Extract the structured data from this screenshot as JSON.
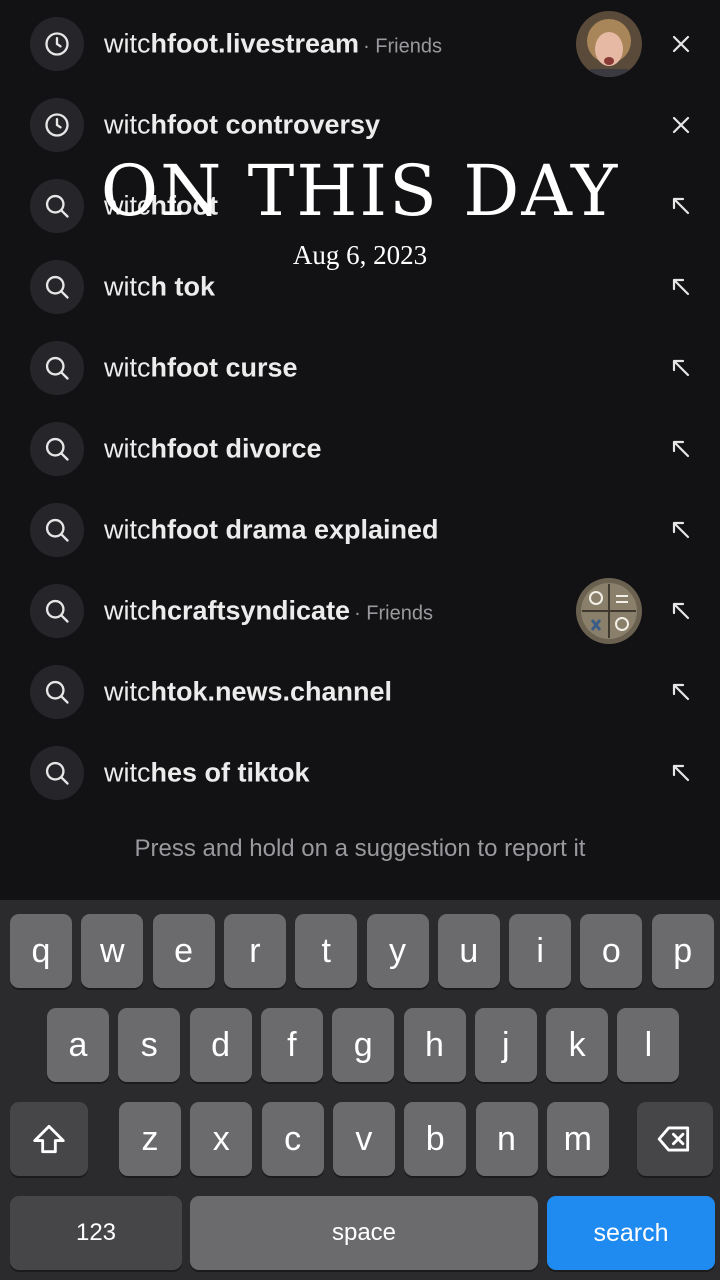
{
  "overlay": {
    "title": "ON THIS DAY",
    "date": "Aug 6, 2023"
  },
  "suggestions": [
    {
      "icon": "clock-icon",
      "prefix": "witc",
      "rest": "hfoot.livestream",
      "tag": "· Friends",
      "action": "remove-icon",
      "avatar": "person"
    },
    {
      "icon": "clock-icon",
      "prefix": "witc",
      "rest": "hfoot controversy",
      "tag": "",
      "action": "remove-icon",
      "avatar": ""
    },
    {
      "icon": "search-icon",
      "prefix": "witc",
      "rest": "hfoot",
      "tag": "",
      "action": "arrow-up-left-icon",
      "avatar": ""
    },
    {
      "icon": "search-icon",
      "prefix": "witc",
      "rest": "h tok",
      "tag": "",
      "action": "arrow-up-left-icon",
      "avatar": ""
    },
    {
      "icon": "search-icon",
      "prefix": "witc",
      "rest": "hfoot curse",
      "tag": "",
      "action": "arrow-up-left-icon",
      "avatar": ""
    },
    {
      "icon": "search-icon",
      "prefix": "witc",
      "rest": "hfoot divorce",
      "tag": "",
      "action": "arrow-up-left-icon",
      "avatar": ""
    },
    {
      "icon": "search-icon",
      "prefix": "witc",
      "rest": "hfoot drama explained",
      "tag": "",
      "action": "arrow-up-left-icon",
      "avatar": ""
    },
    {
      "icon": "search-icon",
      "prefix": "witc",
      "rest": "hcraftsyndicate",
      "tag": "· Friends",
      "action": "arrow-up-left-icon",
      "avatar": "symbols"
    },
    {
      "icon": "search-icon",
      "prefix": "witc",
      "rest": "htok.news.channel",
      "tag": "",
      "action": "arrow-up-left-icon",
      "avatar": ""
    },
    {
      "icon": "search-icon",
      "prefix": "witc",
      "rest": "hes of tiktok",
      "tag": "",
      "action": "arrow-up-left-icon",
      "avatar": ""
    }
  ],
  "hint": "Press and hold on a suggestion to report it",
  "keyboard": {
    "row1": [
      "q",
      "w",
      "e",
      "r",
      "t",
      "y",
      "u",
      "i",
      "o",
      "p"
    ],
    "row2": [
      "a",
      "s",
      "d",
      "f",
      "g",
      "h",
      "j",
      "k",
      "l"
    ],
    "row3": [
      "z",
      "x",
      "c",
      "v",
      "b",
      "n",
      "m"
    ],
    "numbers_label": "123",
    "space_label": "space",
    "search_label": "search",
    "shift_icon": "shift-icon",
    "backspace_icon": "backspace-icon"
  },
  "colors": {
    "background": "#121214",
    "search_key": "#1f8bf0",
    "key": "#6b6b6e",
    "key_dark": "#464649"
  }
}
